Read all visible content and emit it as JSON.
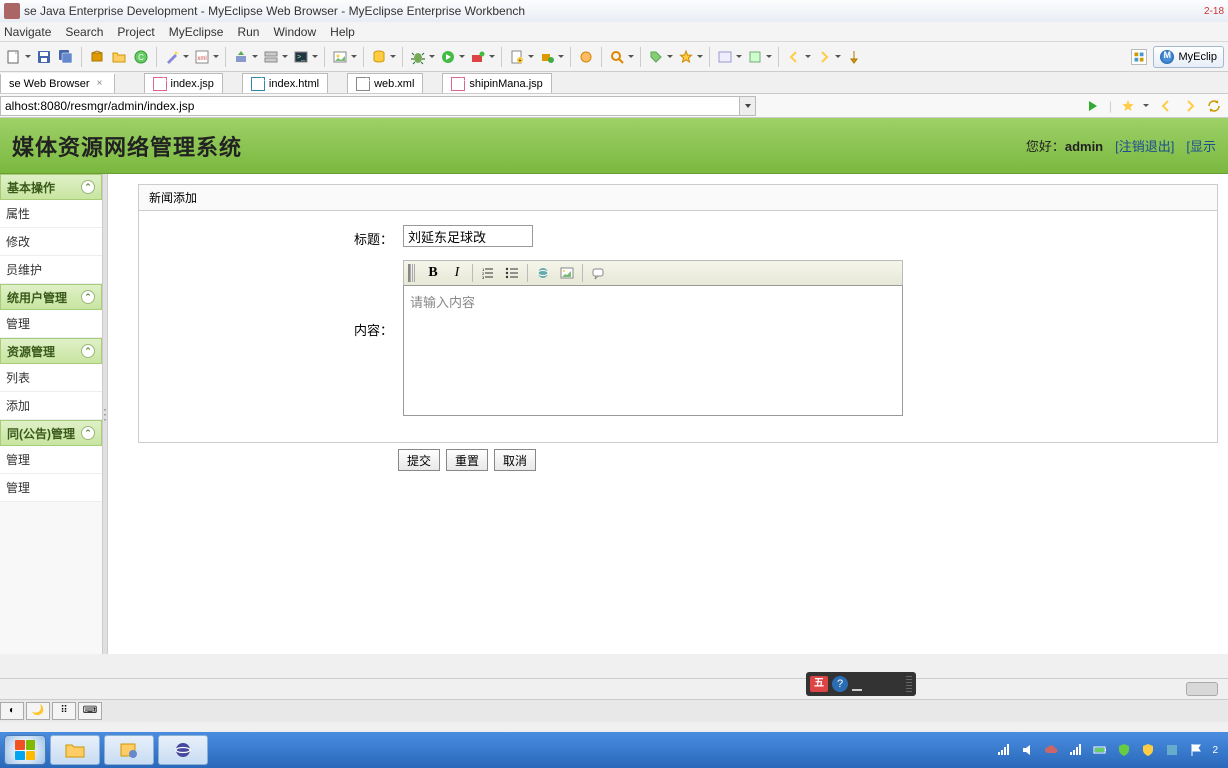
{
  "window": {
    "title": "se Java Enterprise Development - MyEclipse Web Browser - MyEclipse Enterprise Workbench",
    "corner": "2-18"
  },
  "menu": [
    "Navigate",
    "Search",
    "Project",
    "MyEclipse",
    "Run",
    "Window",
    "Help"
  ],
  "perspective": "MyEclip",
  "tabs": [
    {
      "label": "se Web Browser",
      "active": true,
      "icon": "browser"
    },
    {
      "label": "index.jsp",
      "active": false,
      "icon": "jsp"
    },
    {
      "label": "index.html",
      "active": false,
      "icon": "html"
    },
    {
      "label": "web.xml",
      "active": false,
      "icon": "xml"
    },
    {
      "label": "shipinMana.jsp",
      "active": false,
      "icon": "jsp"
    }
  ],
  "address": "alhost:8080/resmgr/admin/index.jsp",
  "page": {
    "title": "媒体资源网络管理系统",
    "greeting_label": "您好：",
    "username": "admin",
    "logout": "[注销退出]",
    "show": "[显示"
  },
  "sidebar": [
    {
      "head": "基本操作",
      "items": [
        "属性",
        "修改",
        "员维护"
      ]
    },
    {
      "head": "统用户管理",
      "items": [
        "管理"
      ]
    },
    {
      "head": "资源管理",
      "items": [
        "列表",
        "添加"
      ]
    },
    {
      "head": "同(公告)管理",
      "items": [
        "管理",
        "管理"
      ]
    }
  ],
  "form": {
    "panel_title": "新闻添加",
    "title_label": "标题：",
    "title_value": "刘延东足球改",
    "content_label": "内容：",
    "content_placeholder": "请输入内容",
    "submit": "提交",
    "reset": "重置",
    "cancel": "取消"
  },
  "ime": {
    "badge": "五",
    "help": "?"
  }
}
